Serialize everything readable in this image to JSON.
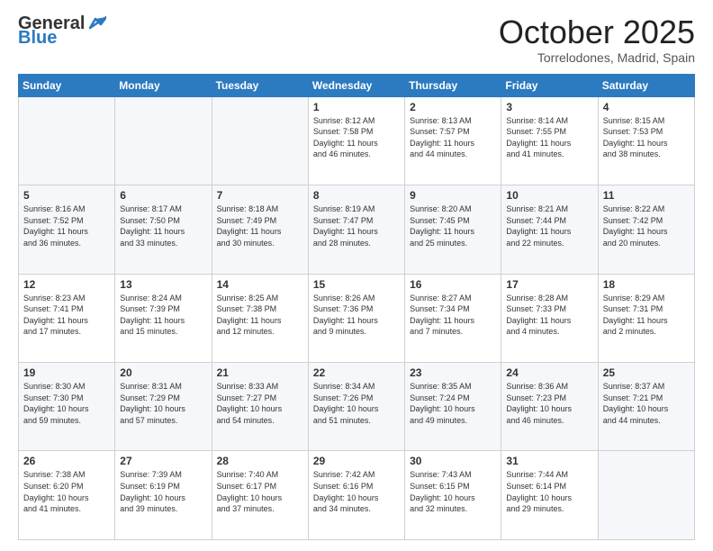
{
  "header": {
    "logo_general": "General",
    "logo_blue": "Blue",
    "month_title": "October 2025",
    "location": "Torrelodones, Madrid, Spain"
  },
  "weekdays": [
    "Sunday",
    "Monday",
    "Tuesday",
    "Wednesday",
    "Thursday",
    "Friday",
    "Saturday"
  ],
  "weeks": [
    [
      {
        "day": "",
        "info": ""
      },
      {
        "day": "",
        "info": ""
      },
      {
        "day": "",
        "info": ""
      },
      {
        "day": "1",
        "info": "Sunrise: 8:12 AM\nSunset: 7:58 PM\nDaylight: 11 hours\nand 46 minutes."
      },
      {
        "day": "2",
        "info": "Sunrise: 8:13 AM\nSunset: 7:57 PM\nDaylight: 11 hours\nand 44 minutes."
      },
      {
        "day": "3",
        "info": "Sunrise: 8:14 AM\nSunset: 7:55 PM\nDaylight: 11 hours\nand 41 minutes."
      },
      {
        "day": "4",
        "info": "Sunrise: 8:15 AM\nSunset: 7:53 PM\nDaylight: 11 hours\nand 38 minutes."
      }
    ],
    [
      {
        "day": "5",
        "info": "Sunrise: 8:16 AM\nSunset: 7:52 PM\nDaylight: 11 hours\nand 36 minutes."
      },
      {
        "day": "6",
        "info": "Sunrise: 8:17 AM\nSunset: 7:50 PM\nDaylight: 11 hours\nand 33 minutes."
      },
      {
        "day": "7",
        "info": "Sunrise: 8:18 AM\nSunset: 7:49 PM\nDaylight: 11 hours\nand 30 minutes."
      },
      {
        "day": "8",
        "info": "Sunrise: 8:19 AM\nSunset: 7:47 PM\nDaylight: 11 hours\nand 28 minutes."
      },
      {
        "day": "9",
        "info": "Sunrise: 8:20 AM\nSunset: 7:45 PM\nDaylight: 11 hours\nand 25 minutes."
      },
      {
        "day": "10",
        "info": "Sunrise: 8:21 AM\nSunset: 7:44 PM\nDaylight: 11 hours\nand 22 minutes."
      },
      {
        "day": "11",
        "info": "Sunrise: 8:22 AM\nSunset: 7:42 PM\nDaylight: 11 hours\nand 20 minutes."
      }
    ],
    [
      {
        "day": "12",
        "info": "Sunrise: 8:23 AM\nSunset: 7:41 PM\nDaylight: 11 hours\nand 17 minutes."
      },
      {
        "day": "13",
        "info": "Sunrise: 8:24 AM\nSunset: 7:39 PM\nDaylight: 11 hours\nand 15 minutes."
      },
      {
        "day": "14",
        "info": "Sunrise: 8:25 AM\nSunset: 7:38 PM\nDaylight: 11 hours\nand 12 minutes."
      },
      {
        "day": "15",
        "info": "Sunrise: 8:26 AM\nSunset: 7:36 PM\nDaylight: 11 hours\nand 9 minutes."
      },
      {
        "day": "16",
        "info": "Sunrise: 8:27 AM\nSunset: 7:34 PM\nDaylight: 11 hours\nand 7 minutes."
      },
      {
        "day": "17",
        "info": "Sunrise: 8:28 AM\nSunset: 7:33 PM\nDaylight: 11 hours\nand 4 minutes."
      },
      {
        "day": "18",
        "info": "Sunrise: 8:29 AM\nSunset: 7:31 PM\nDaylight: 11 hours\nand 2 minutes."
      }
    ],
    [
      {
        "day": "19",
        "info": "Sunrise: 8:30 AM\nSunset: 7:30 PM\nDaylight: 10 hours\nand 59 minutes."
      },
      {
        "day": "20",
        "info": "Sunrise: 8:31 AM\nSunset: 7:29 PM\nDaylight: 10 hours\nand 57 minutes."
      },
      {
        "day": "21",
        "info": "Sunrise: 8:33 AM\nSunset: 7:27 PM\nDaylight: 10 hours\nand 54 minutes."
      },
      {
        "day": "22",
        "info": "Sunrise: 8:34 AM\nSunset: 7:26 PM\nDaylight: 10 hours\nand 51 minutes."
      },
      {
        "day": "23",
        "info": "Sunrise: 8:35 AM\nSunset: 7:24 PM\nDaylight: 10 hours\nand 49 minutes."
      },
      {
        "day": "24",
        "info": "Sunrise: 8:36 AM\nSunset: 7:23 PM\nDaylight: 10 hours\nand 46 minutes."
      },
      {
        "day": "25",
        "info": "Sunrise: 8:37 AM\nSunset: 7:21 PM\nDaylight: 10 hours\nand 44 minutes."
      }
    ],
    [
      {
        "day": "26",
        "info": "Sunrise: 7:38 AM\nSunset: 6:20 PM\nDaylight: 10 hours\nand 41 minutes."
      },
      {
        "day": "27",
        "info": "Sunrise: 7:39 AM\nSunset: 6:19 PM\nDaylight: 10 hours\nand 39 minutes."
      },
      {
        "day": "28",
        "info": "Sunrise: 7:40 AM\nSunset: 6:17 PM\nDaylight: 10 hours\nand 37 minutes."
      },
      {
        "day": "29",
        "info": "Sunrise: 7:42 AM\nSunset: 6:16 PM\nDaylight: 10 hours\nand 34 minutes."
      },
      {
        "day": "30",
        "info": "Sunrise: 7:43 AM\nSunset: 6:15 PM\nDaylight: 10 hours\nand 32 minutes."
      },
      {
        "day": "31",
        "info": "Sunrise: 7:44 AM\nSunset: 6:14 PM\nDaylight: 10 hours\nand 29 minutes."
      },
      {
        "day": "",
        "info": ""
      }
    ]
  ]
}
